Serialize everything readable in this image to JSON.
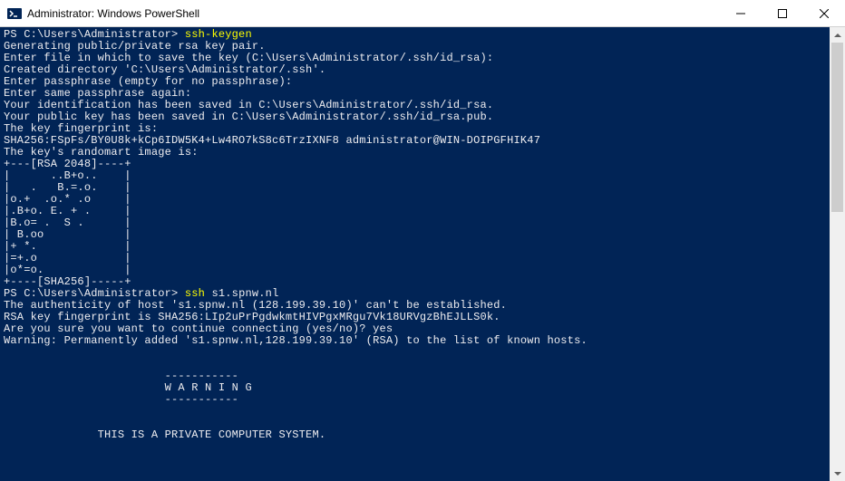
{
  "window": {
    "title": "Administrator: Windows PowerShell"
  },
  "lines": [
    {
      "prompt": "PS C:\\Users\\Administrator> ",
      "cmd": "ssh-keygen",
      "rest": ""
    },
    {
      "text": "Generating public/private rsa key pair."
    },
    {
      "text": "Enter file in which to save the key (C:\\Users\\Administrator/.ssh/id_rsa):"
    },
    {
      "text": "Created directory 'C:\\Users\\Administrator/.ssh'."
    },
    {
      "text": "Enter passphrase (empty for no passphrase):"
    },
    {
      "text": "Enter same passphrase again:"
    },
    {
      "text": "Your identification has been saved in C:\\Users\\Administrator/.ssh/id_rsa."
    },
    {
      "text": "Your public key has been saved in C:\\Users\\Administrator/.ssh/id_rsa.pub."
    },
    {
      "text": "The key fingerprint is:"
    },
    {
      "text": "SHA256:FSpFs/BY0U8k+kCp6IDW5K4+Lw4RO7kS8c6TrzIXNF8 administrator@WIN-DOIPGFHIK47"
    },
    {
      "text": "The key's randomart image is:"
    },
    {
      "text": "+---[RSA 2048]----+"
    },
    {
      "text": "|      ..B+o..    |"
    },
    {
      "text": "|   .   B.=.o.    |"
    },
    {
      "text": "|o.+  .o.* .o     |"
    },
    {
      "text": "|.B+o. E. + .     |"
    },
    {
      "text": "|B.o= .  S .      |"
    },
    {
      "text": "| B.oo            |"
    },
    {
      "text": "|+ *.             |"
    },
    {
      "text": "|=+.o             |"
    },
    {
      "text": "|o*=o.            |"
    },
    {
      "text": "+----[SHA256]-----+"
    },
    {
      "prompt": "PS C:\\Users\\Administrator> ",
      "cmd": "ssh",
      "rest": " s1.spnw.nl"
    },
    {
      "text": "The authenticity of host 's1.spnw.nl (128.199.39.10)' can't be established."
    },
    {
      "text": "RSA key fingerprint is SHA256:LIp2uPrPgdwkmtHIVPgxMRgu7Vk18URVgzBhEJLLS0k."
    },
    {
      "text": "Are you sure you want to continue connecting (yes/no)? yes"
    },
    {
      "text": "Warning: Permanently added 's1.spnw.nl,128.199.39.10' (RSA) to the list of known hosts."
    },
    {
      "text": ""
    },
    {
      "text": ""
    },
    {
      "text": "                        -----------"
    },
    {
      "text": "                        W A R N I N G"
    },
    {
      "text": "                        -----------"
    },
    {
      "text": ""
    },
    {
      "text": ""
    },
    {
      "text": "              THIS IS A PRIVATE COMPUTER SYSTEM."
    }
  ]
}
